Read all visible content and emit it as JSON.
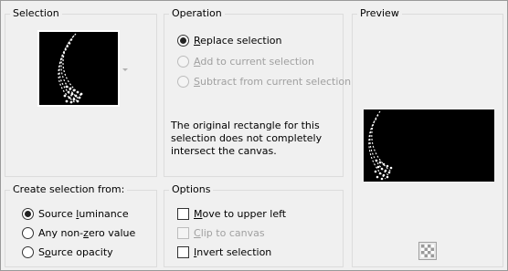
{
  "selection": {
    "title": "Selection"
  },
  "operation": {
    "title": "Operation",
    "options": [
      {
        "label_pre": "",
        "label_ul": "R",
        "label_post": "eplace selection",
        "checked": true,
        "enabled": true
      },
      {
        "label_pre": "",
        "label_ul": "A",
        "label_post": "dd to current selection",
        "checked": false,
        "enabled": false
      },
      {
        "label_pre": "",
        "label_ul": "S",
        "label_post": "ubtract from current selection",
        "checked": false,
        "enabled": false
      }
    ],
    "note": "The original rectangle for this selection does not completely intersect the canvas."
  },
  "preview": {
    "title": "Preview",
    "background_button_icon": "checkerboard-icon"
  },
  "create_from": {
    "title": "Create selection from:",
    "options": [
      {
        "label_pre": "Source ",
        "label_ul": "l",
        "label_post": "uminance",
        "checked": true
      },
      {
        "label_pre": "Any non-",
        "label_ul": "z",
        "label_post": "ero value",
        "checked": false
      },
      {
        "label_pre": "S",
        "label_ul": "o",
        "label_post": "urce opacity",
        "checked": false
      }
    ]
  },
  "options": {
    "title": "Options",
    "items": [
      {
        "label_pre": "",
        "label_ul": "M",
        "label_post": "ove to upper left",
        "checked": false,
        "enabled": true
      },
      {
        "label_pre": "",
        "label_ul": "C",
        "label_post": "lip to canvas",
        "checked": false,
        "enabled": false
      },
      {
        "label_pre": "",
        "label_ul": "I",
        "label_post": "nvert selection",
        "checked": false,
        "enabled": true
      }
    ]
  }
}
